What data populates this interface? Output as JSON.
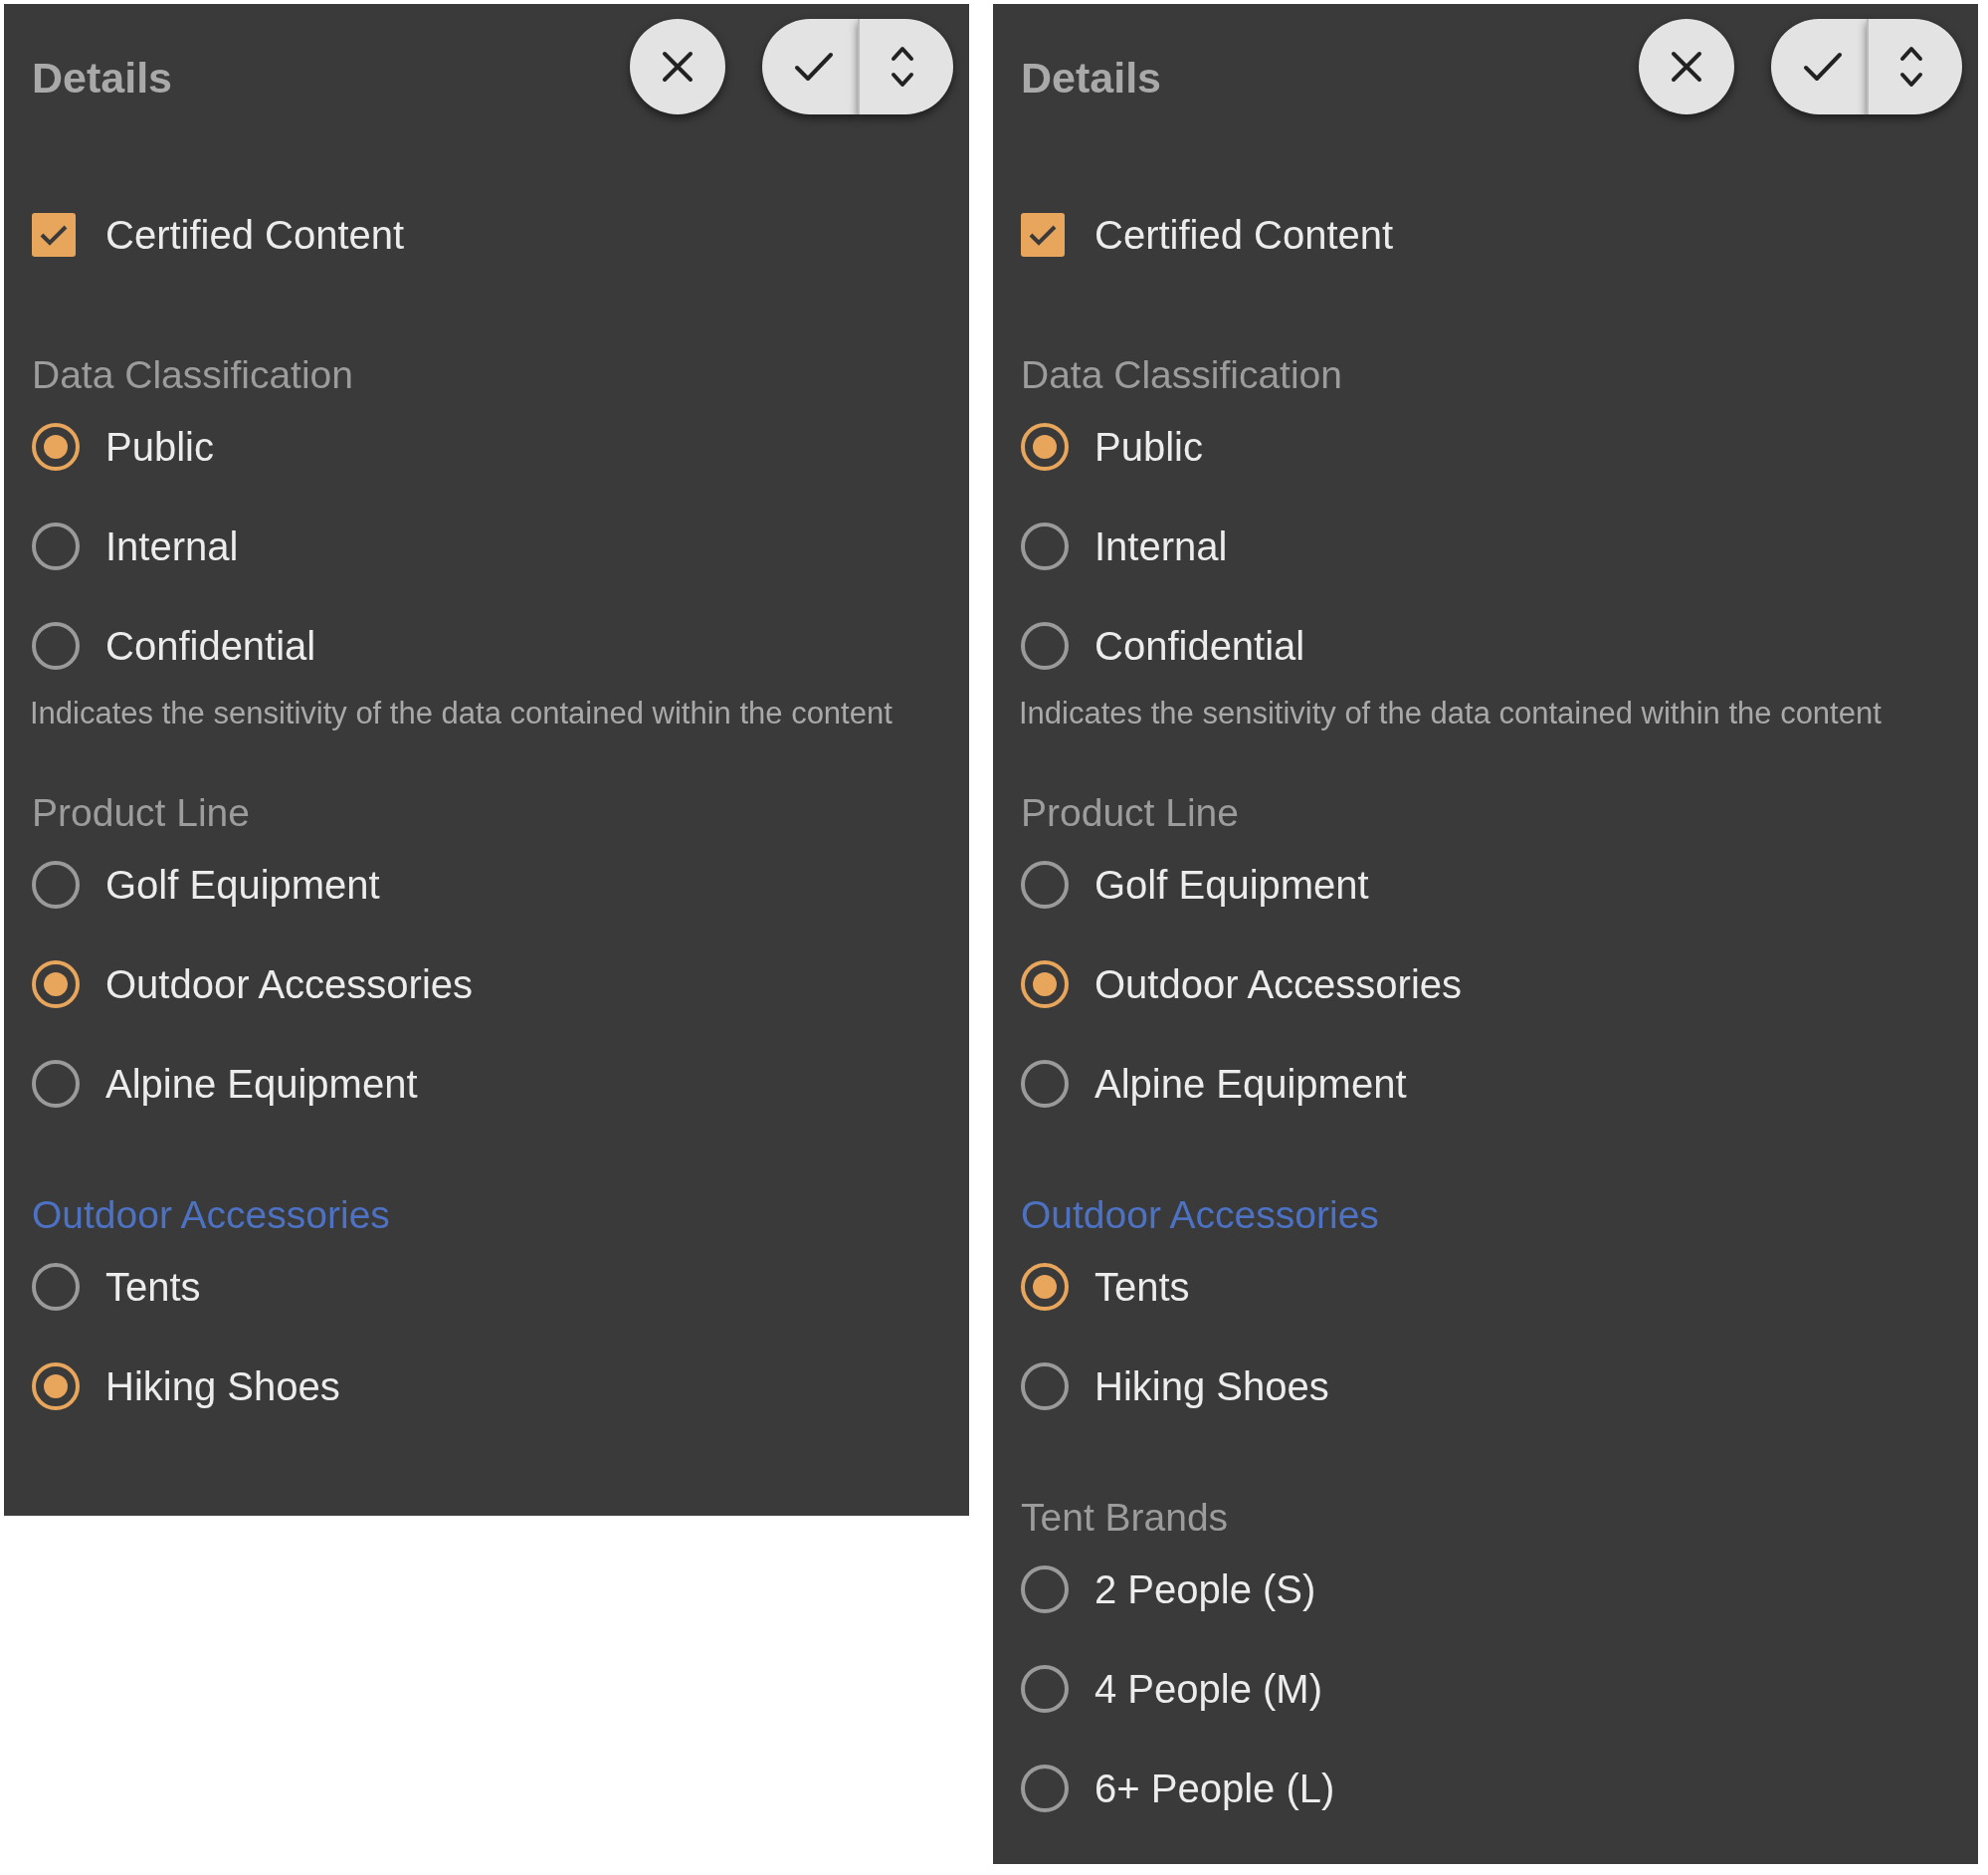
{
  "panels": [
    {
      "title": "Details",
      "certified": {
        "label": "Certified Content",
        "checked": true
      },
      "groups": [
        {
          "heading": "Data Classification",
          "highlighted": false,
          "options": [
            {
              "label": "Public",
              "selected": true
            },
            {
              "label": "Internal",
              "selected": false
            },
            {
              "label": "Confidential",
              "selected": false
            }
          ],
          "description": "Indicates the sensitivity of the data contained within the content"
        },
        {
          "heading": "Product Line",
          "highlighted": false,
          "options": [
            {
              "label": "Golf Equipment",
              "selected": false
            },
            {
              "label": "Outdoor Accessories",
              "selected": true
            },
            {
              "label": "Alpine Equipment",
              "selected": false
            }
          ]
        },
        {
          "heading": "Outdoor Accessories",
          "highlighted": true,
          "options": [
            {
              "label": "Tents",
              "selected": false
            },
            {
              "label": "Hiking Shoes",
              "selected": true
            }
          ]
        }
      ]
    },
    {
      "title": "Details",
      "certified": {
        "label": "Certified Content",
        "checked": true
      },
      "groups": [
        {
          "heading": "Data Classification",
          "highlighted": false,
          "options": [
            {
              "label": "Public",
              "selected": true
            },
            {
              "label": "Internal",
              "selected": false
            },
            {
              "label": "Confidential",
              "selected": false
            }
          ],
          "description": "Indicates the sensitivity of the data contained within the content"
        },
        {
          "heading": "Product Line",
          "highlighted": false,
          "options": [
            {
              "label": "Golf Equipment",
              "selected": false
            },
            {
              "label": "Outdoor Accessories",
              "selected": true
            },
            {
              "label": "Alpine Equipment",
              "selected": false
            }
          ]
        },
        {
          "heading": "Outdoor Accessories",
          "highlighted": true,
          "options": [
            {
              "label": "Tents",
              "selected": true
            },
            {
              "label": "Hiking Shoes",
              "selected": false
            }
          ]
        },
        {
          "heading": "Tent Brands",
          "highlighted": false,
          "options": [
            {
              "label": "2 People (S)",
              "selected": false
            },
            {
              "label": "4 People (M)",
              "selected": false
            },
            {
              "label": "6+ People (L)",
              "selected": false
            }
          ]
        }
      ]
    }
  ]
}
